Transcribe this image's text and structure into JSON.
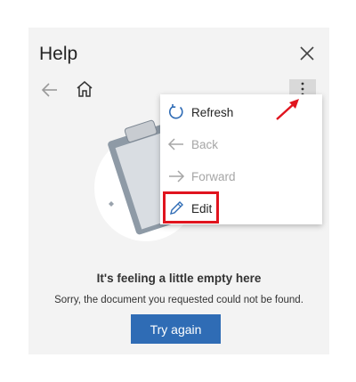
{
  "panel": {
    "title": "Help",
    "close_icon": "close-icon",
    "back_icon": "arrow-left-icon",
    "home_icon": "home-icon",
    "more_icon": "more-vertical-icon"
  },
  "menu": {
    "items": [
      {
        "label": "Refresh",
        "icon": "refresh-icon",
        "enabled": true
      },
      {
        "label": "Back",
        "icon": "arrow-left-icon",
        "enabled": false
      },
      {
        "label": "Forward",
        "icon": "arrow-right-icon",
        "enabled": false
      },
      {
        "label": "Edit",
        "icon": "pencil-icon",
        "enabled": true
      }
    ]
  },
  "empty_state": {
    "title": "It's feeling a little empty here",
    "message": "Sorry, the document you requested could not be found.",
    "button_label": "Try again",
    "illustration_icon": "clipboard-illustration"
  },
  "annotations": {
    "highlight_color": "#e0141e",
    "highlighted_item": "Edit",
    "arrow_icon": "red-arrow-icon"
  },
  "colors": {
    "accent": "#2f6cb5",
    "refresh_icon": "#2f6cb5",
    "pane_background": "#f3f3f3"
  }
}
